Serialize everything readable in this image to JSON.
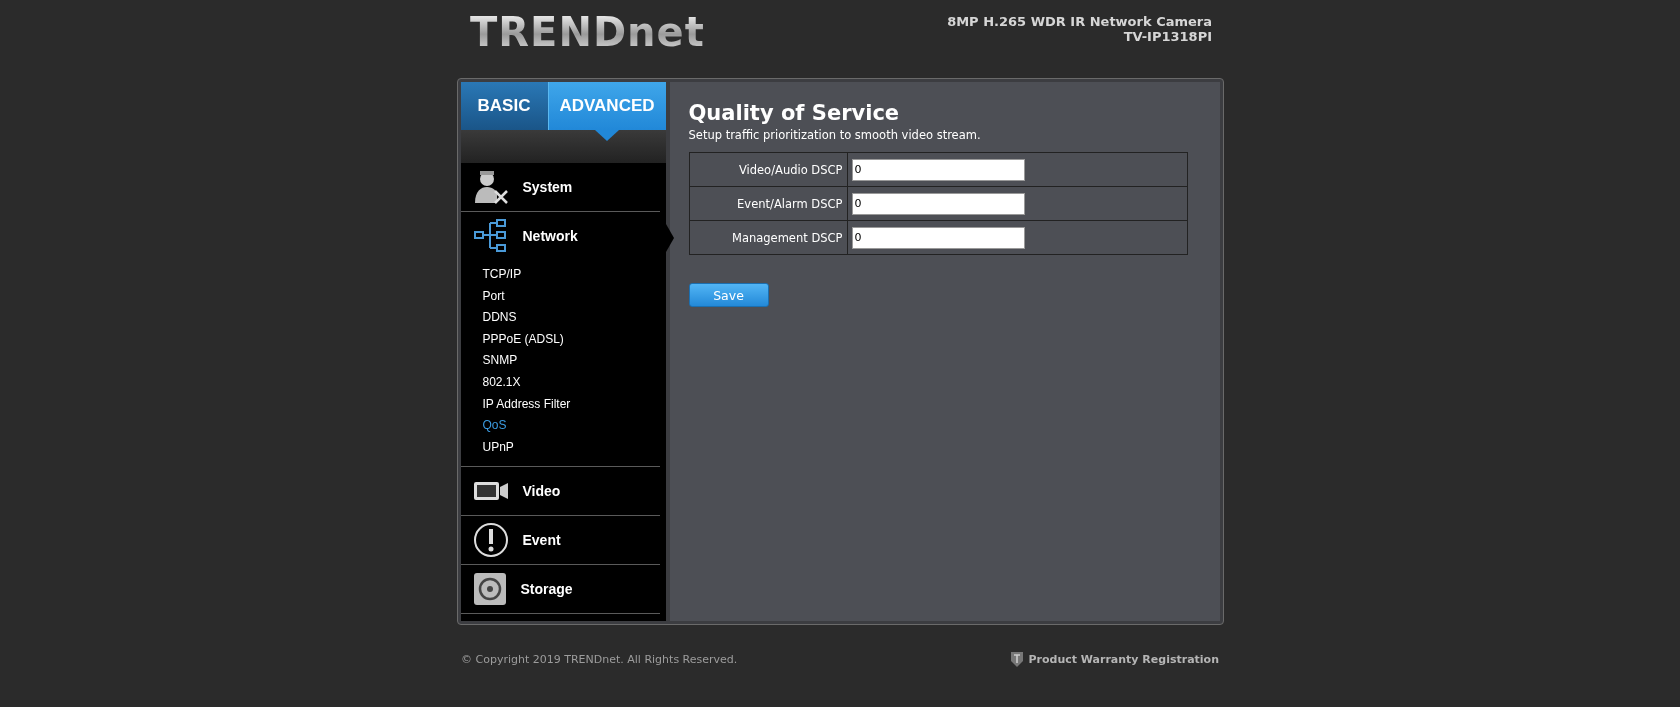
{
  "header": {
    "logo": "TRENDnet",
    "product": "8MP H.265 WDR IR Network Camera",
    "model": "TV-IP1318PI"
  },
  "tabs": [
    {
      "label": "BASIC",
      "selected": false
    },
    {
      "label": "ADVANCED",
      "selected": true
    }
  ],
  "sidebar": {
    "sections": [
      {
        "kind": "system",
        "label": "System",
        "expanded": false
      },
      {
        "kind": "network",
        "label": "Network",
        "expanded": true,
        "children": [
          {
            "label": "TCP/IP",
            "selected": false
          },
          {
            "label": "Port",
            "selected": false
          },
          {
            "label": "DDNS",
            "selected": false
          },
          {
            "label": "PPPoE (ADSL)",
            "selected": false
          },
          {
            "label": "SNMP",
            "selected": false
          },
          {
            "label": "802.1X",
            "selected": false
          },
          {
            "label": "IP Address Filter",
            "selected": false
          },
          {
            "label": "QoS",
            "selected": true
          },
          {
            "label": "UPnP",
            "selected": false
          }
        ]
      },
      {
        "kind": "video",
        "label": "Video",
        "expanded": false
      },
      {
        "kind": "event",
        "label": "Event",
        "expanded": false
      },
      {
        "kind": "storage",
        "label": "Storage",
        "expanded": false
      }
    ]
  },
  "content": {
    "title": "Quality of Service",
    "subtitle": "Setup traffic prioritization to smooth video stream.",
    "fields": [
      {
        "label": "Video/Audio DSCP",
        "value": "0"
      },
      {
        "label": "Event/Alarm DSCP",
        "value": "0"
      },
      {
        "label": "Management DSCP",
        "value": "0"
      }
    ],
    "save_button": "Save"
  },
  "footer": {
    "copyright": "© Copyright 2019 TRENDnet. All Rights Reserved.",
    "warranty_link": "Product Warranty Registration"
  }
}
